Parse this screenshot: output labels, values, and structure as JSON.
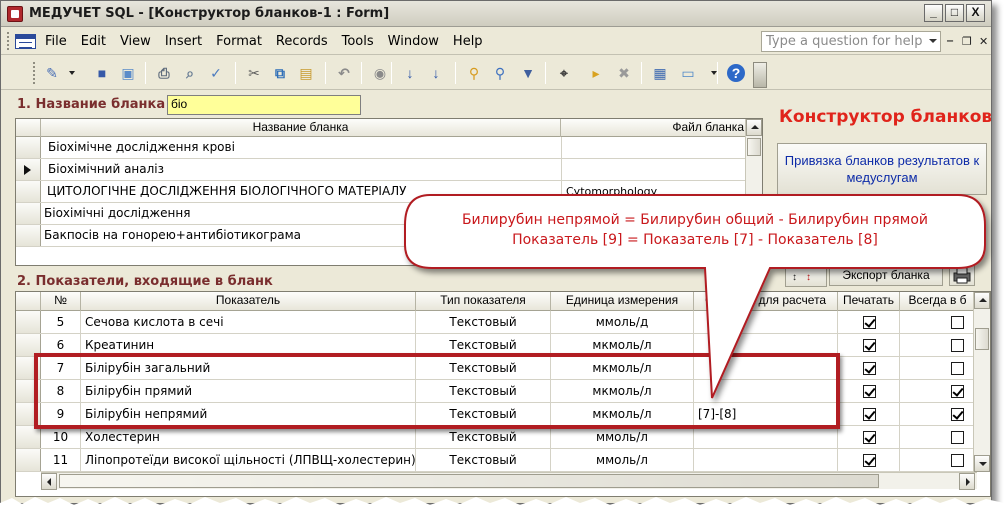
{
  "window": {
    "title": "МЕДУЧЕТ SQL - [Конструктор бланков-1 : Form]",
    "minimize": "_",
    "maximize": "□",
    "close": "X"
  },
  "menu": {
    "items": [
      "File",
      "Edit",
      "View",
      "Insert",
      "Format",
      "Records",
      "Tools",
      "Window",
      "Help"
    ],
    "help_placeholder": "Type a question for help"
  },
  "section1": {
    "label": "1. Название бланка",
    "filter_value": "біо",
    "headers": [
      "Название бланка",
      "Файл бланка"
    ],
    "rows": [
      {
        "name": "Біохімічне дослідження крові",
        "file": "",
        "current": false
      },
      {
        "name": "Біохімічний аналіз",
        "file": "",
        "current": true
      },
      {
        "name": "ЦИТОЛОГІЧНЕ ДОСЛІДЖЕННЯ БІОЛОГІЧНОГО МАТЕРІАЛУ",
        "file": "Cytomorphology",
        "current": false
      },
      {
        "name": "Біохімічні дослідження",
        "file": "",
        "current": false
      },
      {
        "name": "Бакпосів  на гонорею+антибіотикограма",
        "file": "",
        "current": false
      }
    ]
  },
  "panel": {
    "title": "Конструктор бланков",
    "link_button": "Привязка бланков результатов к медуслугам"
  },
  "section2": {
    "label": "2. Показатели, входящие в бланк",
    "export_button": "Экспорт бланка",
    "headers": [
      "№",
      "Показатель",
      "Тип показателя",
      "Единица измерения",
      "Формула для расчета",
      "Печатать",
      "Всегда в б"
    ],
    "rows": [
      {
        "num": "5",
        "name": "Сечова кислота в сечі",
        "type": "Текстовый",
        "unit": "ммоль/д",
        "formula": "",
        "print": true,
        "always": false
      },
      {
        "num": "6",
        "name": "Креатинин",
        "type": "Текстовый",
        "unit": "мкмоль/л",
        "formula": "",
        "print": true,
        "always": false
      },
      {
        "num": "7",
        "name": "Білірубін загальний",
        "type": "Текстовый",
        "unit": "мкмоль/л",
        "formula": "",
        "print": true,
        "always": false
      },
      {
        "num": "8",
        "name": "Білірубін прямий",
        "type": "Текстовый",
        "unit": "мкмоль/л",
        "formula": "",
        "print": true,
        "always": true
      },
      {
        "num": "9",
        "name": "Білірубін непрямий",
        "type": "Текстовый",
        "unit": "мкмоль/л",
        "formula": "[7]-[8]",
        "print": true,
        "always": true
      },
      {
        "num": "10",
        "name": "Холестерин",
        "type": "Текстовый",
        "unit": "ммоль/л",
        "formula": "",
        "print": true,
        "always": false
      },
      {
        "num": "11",
        "name": "Ліпопротеїди високої щільності (ЛПВЩ-холестерин)",
        "type": "Текстовый",
        "unit": "ммоль/л",
        "formula": "",
        "print": true,
        "always": false
      }
    ]
  },
  "callout": {
    "line1": "Билирубин непрямой = Билирубин общий - Билирубин прямой",
    "line2": "Показатель [9] = Показатель [7] - Показатель [8]"
  },
  "colors": {
    "title_red": "#e0241b",
    "callout_red": "#c9181c",
    "highlight_border": "#b11d22",
    "filter_bg": "#ffff99",
    "section_label": "#7a2e2e",
    "link_blue": "#0e2ca8"
  },
  "icons": {
    "toolbar": [
      "design-view-icon",
      "save-icon",
      "search-file-icon",
      "print-icon",
      "print-preview-icon",
      "spelling-icon",
      "cut-icon",
      "copy-icon",
      "paste-icon",
      "undo-icon",
      "hyperlink-icon",
      "sort-ascending-icon",
      "sort-descending-icon",
      "filter-by-selection-icon",
      "filter-by-form-icon",
      "apply-filter-icon",
      "find-icon",
      "new-record-icon",
      "delete-record-icon",
      "database-window-icon",
      "new-object-icon",
      "help-icon"
    ]
  }
}
